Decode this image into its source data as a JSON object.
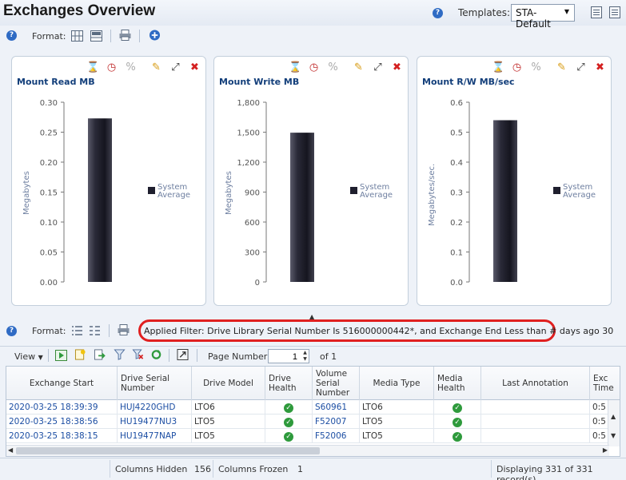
{
  "header": {
    "title": "Exchanges Overview",
    "templates_label": "Templates:",
    "templates_value": "STA-Default"
  },
  "top_toolbar": {
    "format_label": "Format:"
  },
  "charts": [
    {
      "title": "Mount Read MB"
    },
    {
      "title": "Mount Write MB"
    },
    {
      "title": "Mount R/W MB/sec"
    }
  ],
  "chart_data": [
    {
      "type": "bar",
      "title": "Mount Read MB",
      "ylabel": "Megabytes",
      "yticks": [
        "0.30",
        "0.25",
        "0.20",
        "0.15",
        "0.10",
        "0.05",
        "0.00"
      ],
      "ylim": [
        0,
        0.3
      ],
      "series": [
        {
          "name": "System Average",
          "values": [
            0.273
          ]
        }
      ],
      "legend": [
        "System",
        "Average"
      ],
      "grid": false,
      "legend_position": "right"
    },
    {
      "type": "bar",
      "title": "Mount Write MB",
      "ylabel": "Megabytes",
      "yticks": [
        "1,800",
        "1,500",
        "1,200",
        "900",
        "600",
        "300",
        "0"
      ],
      "ylim": [
        0,
        1800
      ],
      "series": [
        {
          "name": "System Average",
          "values": [
            1495
          ]
        }
      ],
      "legend": [
        "System",
        "Average"
      ],
      "grid": false,
      "legend_position": "right"
    },
    {
      "type": "bar",
      "title": "Mount R/W MB/sec",
      "ylabel": "Megabytes/sec.",
      "yticks": [
        "0.6",
        "0.5",
        "0.4",
        "0.3",
        "0.2",
        "0.1",
        "0.0"
      ],
      "ylim": [
        0,
        0.6
      ],
      "series": [
        {
          "name": "System Average",
          "values": [
            0.54
          ]
        }
      ],
      "legend": [
        "System",
        "Average"
      ],
      "grid": false,
      "legend_position": "right"
    }
  ],
  "filter_toolbar": {
    "format_label": "Format:",
    "applied_filter": "Applied Filter: Drive Library Serial Number Is 516000000442*, and Exchange End Less than # days ago 30"
  },
  "table_toolbar": {
    "view_label": "View",
    "page_label": "Page Number:",
    "page_value": "1",
    "page_of": "of 1"
  },
  "table": {
    "columns": [
      "Exchange Start",
      "Drive Serial Number",
      "Drive Model",
      "Drive Health",
      "Volume Serial Number",
      "Media Type",
      "Media Health",
      "Last Annotation",
      "Exc Time"
    ],
    "rows": [
      {
        "start": "2020-03-25 18:39:39",
        "drive_serial": "HUJ4220GHD",
        "model": "LTO6",
        "volume": "S60961",
        "media": "LTO6",
        "time": "0:5"
      },
      {
        "start": "2020-03-25 18:38:56",
        "drive_serial": "HU19477NU3",
        "model": "LTO5",
        "volume": "F52007",
        "media": "LTO5",
        "time": "0:5"
      },
      {
        "start": "2020-03-25 18:38:15",
        "drive_serial": "HU19477NAP",
        "model": "LTO5",
        "volume": "F52006",
        "media": "LTO5",
        "time": "0:5"
      }
    ]
  },
  "footer": {
    "cols_hidden_label": "Columns Hidden",
    "cols_hidden_value": "156",
    "cols_frozen_label": "Columns Frozen",
    "cols_frozen_value": "1",
    "displaying": "Displaying 331 of 331 record(s)"
  },
  "colors": {
    "accent": "#1c4ea3",
    "filter_highlight": "#e02020",
    "bar": "#1f1f2e",
    "ok": "#2e9a3c"
  }
}
